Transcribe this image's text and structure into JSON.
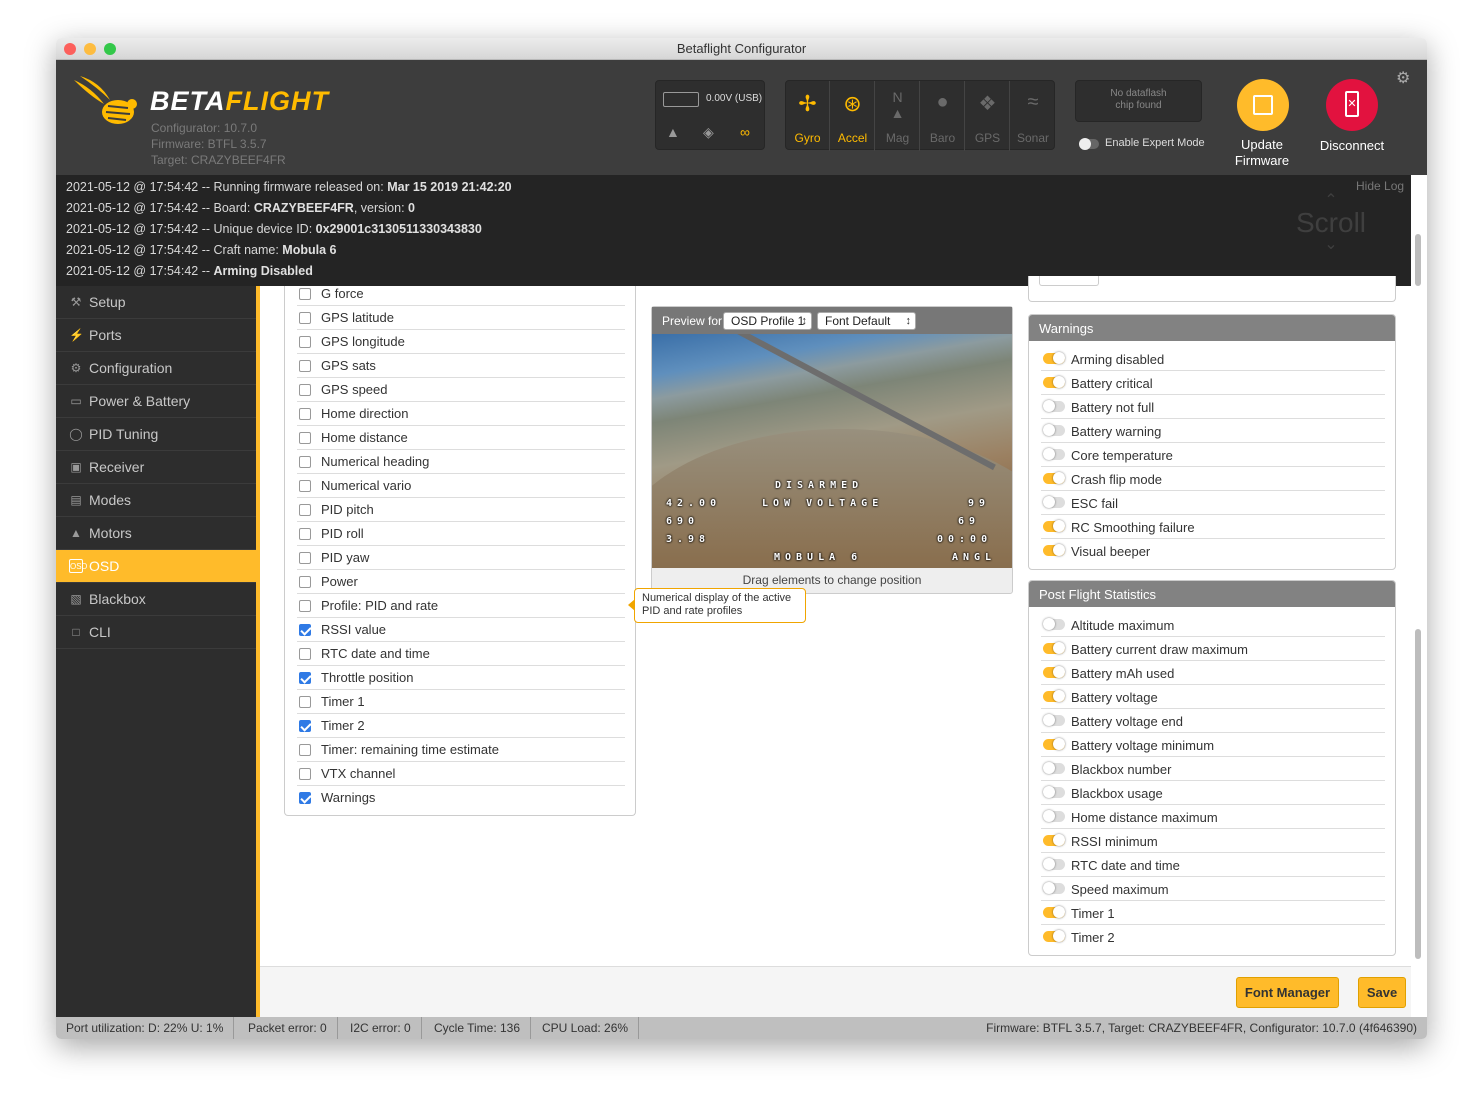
{
  "window_title": "Betaflight Configurator",
  "header": {
    "logo_part1": "BETA",
    "logo_part2": "FLIGHT",
    "configurator": "Configurator: 10.7.0",
    "firmware": "Firmware: BTFL 3.5.7",
    "target": "Target: CRAZYBEEF4FR",
    "battery": "0.00V (USB)",
    "sensors": [
      "Gyro",
      "Accel",
      "Mag",
      "Baro",
      "GPS",
      "Sonar"
    ],
    "dataflash_line1": "No dataflash",
    "dataflash_line2": "chip found",
    "expert_mode": "Enable Expert Mode",
    "update_line1": "Update",
    "update_line2": "Firmware",
    "disconnect": "Disconnect"
  },
  "log": {
    "hide": "Hide Log",
    "scroll": "Scroll",
    "lines": [
      {
        "prefix": "2021-05-12 @ 17:54:42 -- Running firmware released on: ",
        "bold": "Mar 15 2019 21:42:20",
        "suffix": ""
      },
      {
        "prefix": "2021-05-12 @ 17:54:42 -- Board: ",
        "bold": "CRAZYBEEF4FR",
        "suffix": ", version: ",
        "bold2": "0"
      },
      {
        "prefix": "2021-05-12 @ 17:54:42 -- Unique device ID: ",
        "bold": "0x29001c3130511330343830",
        "suffix": ""
      },
      {
        "prefix": "2021-05-12 @ 17:54:42 -- Craft name: ",
        "bold": "Mobula 6",
        "suffix": ""
      },
      {
        "prefix": "2021-05-12 @ 17:54:42 -- ",
        "bold": "Arming Disabled",
        "suffix": ""
      }
    ]
  },
  "nav": [
    "Setup",
    "Ports",
    "Configuration",
    "Power & Battery",
    "PID Tuning",
    "Receiver",
    "Modes",
    "Motors",
    "OSD",
    "Blackbox",
    "CLI"
  ],
  "elements": [
    {
      "label": "G force",
      "checked": false
    },
    {
      "label": "GPS latitude",
      "checked": false
    },
    {
      "label": "GPS longitude",
      "checked": false
    },
    {
      "label": "GPS sats",
      "checked": false
    },
    {
      "label": "GPS speed",
      "checked": false
    },
    {
      "label": "Home direction",
      "checked": false
    },
    {
      "label": "Home distance",
      "checked": false
    },
    {
      "label": "Numerical heading",
      "checked": false
    },
    {
      "label": "Numerical vario",
      "checked": false
    },
    {
      "label": "PID pitch",
      "checked": false
    },
    {
      "label": "PID roll",
      "checked": false
    },
    {
      "label": "PID yaw",
      "checked": false
    },
    {
      "label": "Power",
      "checked": false
    },
    {
      "label": "Profile: PID and rate",
      "checked": false
    },
    {
      "label": "RSSI value",
      "checked": true
    },
    {
      "label": "RTC date and time",
      "checked": false
    },
    {
      "label": "Throttle position",
      "checked": true
    },
    {
      "label": "Timer 1",
      "checked": false
    },
    {
      "label": "Timer 2",
      "checked": true
    },
    {
      "label": "Timer: remaining time estimate",
      "checked": false
    },
    {
      "label": "VTX channel",
      "checked": false
    },
    {
      "label": "Warnings",
      "checked": true
    }
  ],
  "preview": {
    "label": "Preview for",
    "profile": "OSD Profile 1",
    "font": "Font Default",
    "osd_disarmed": "DISARMED",
    "osd_lowvolt": "LOW VOLTAGE",
    "osd_left1": "42.00",
    "osd_left2": "690",
    "osd_left3": "3.98",
    "osd_right1": "99",
    "osd_right2": "69",
    "osd_right3": "00:00",
    "osd_craft": "MOBULA 6",
    "osd_mode": "ANGL",
    "caption": "Drag elements to change position"
  },
  "tooltip": "Numerical display of the active PID and rate profiles",
  "warnings": {
    "title": "Warnings",
    "items": [
      {
        "label": "Arming disabled",
        "on": true
      },
      {
        "label": "Battery critical",
        "on": true
      },
      {
        "label": "Battery not full",
        "on": false
      },
      {
        "label": "Battery warning",
        "on": false
      },
      {
        "label": "Core temperature",
        "on": false
      },
      {
        "label": "Crash flip mode",
        "on": true
      },
      {
        "label": "ESC fail",
        "on": false
      },
      {
        "label": "RC Smoothing failure",
        "on": true
      },
      {
        "label": "Visual beeper",
        "on": true
      }
    ]
  },
  "stats": {
    "title": "Post Flight Statistics",
    "items": [
      {
        "label": "Altitude maximum",
        "on": false
      },
      {
        "label": "Battery current draw maximum",
        "on": true
      },
      {
        "label": "Battery mAh used",
        "on": true
      },
      {
        "label": "Battery voltage",
        "on": true
      },
      {
        "label": "Battery voltage end",
        "on": false
      },
      {
        "label": "Battery voltage minimum",
        "on": true
      },
      {
        "label": "Blackbox number",
        "on": false
      },
      {
        "label": "Blackbox usage",
        "on": false
      },
      {
        "label": "Home distance maximum",
        "on": false
      },
      {
        "label": "RSSI minimum",
        "on": true
      },
      {
        "label": "RTC date and time",
        "on": false
      },
      {
        "label": "Speed maximum",
        "on": false
      },
      {
        "label": "Timer 1",
        "on": true
      },
      {
        "label": "Timer 2",
        "on": true
      }
    ]
  },
  "buttons": {
    "font_manager": "Font Manager",
    "save": "Save"
  },
  "status": {
    "port": "Port utilization: D: 22% U: 1%",
    "packet": "Packet error: 0",
    "i2c": "I2C error: 0",
    "cycle": "Cycle Time: 136",
    "cpu": "CPU Load: 26%",
    "firmware": "Firmware: BTFL 3.5.7, Target: CRAZYBEEF4FR, Configurator: 10.7.0 (4f646390)"
  },
  "colors": {
    "accent": "#ffbb2a",
    "disconnect": "#e2123f",
    "header": "#3d3d3d"
  }
}
